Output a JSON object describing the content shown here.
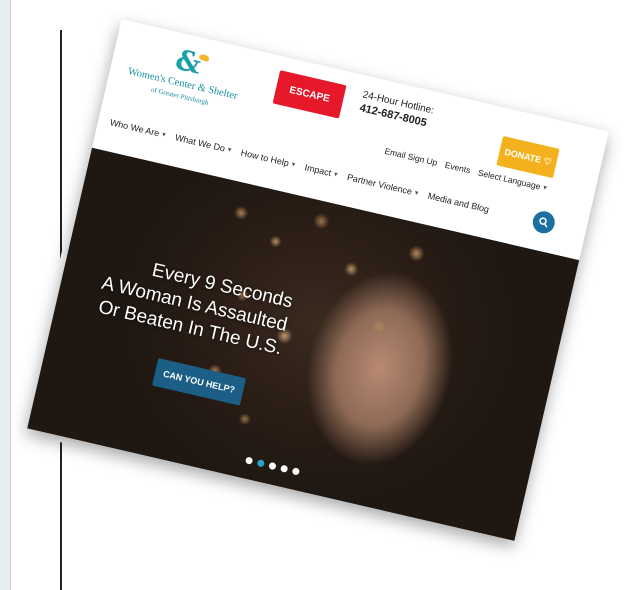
{
  "brand": {
    "name": "Women's Center & Shelter",
    "subtitle": "of Greater Pittsburgh",
    "primary_color": "#1b8fa2",
    "accent_color": "#f3b21d"
  },
  "header": {
    "escape_label": "ESCAPE",
    "hotline_label": "24-Hour Hotline:",
    "hotline_number": "412-687-8005",
    "donate_label": "DONATE ♡",
    "top_links": [
      "Email Sign Up",
      "Events",
      "Select Language"
    ]
  },
  "nav": {
    "items": [
      {
        "label": "Who We Are"
      },
      {
        "label": "What We Do"
      },
      {
        "label": "How to Help"
      },
      {
        "label": "Impact"
      },
      {
        "label": "Partner Violence"
      },
      {
        "label": "Media and Blog"
      }
    ],
    "search_icon": "search-icon"
  },
  "hero": {
    "lines": [
      "Every 9 Seconds",
      "A Woman Is Assaulted",
      "Or Beaten In The U.S."
    ],
    "cta_label": "CAN YOU HELP?",
    "slides": 5,
    "active_slide": 2
  }
}
